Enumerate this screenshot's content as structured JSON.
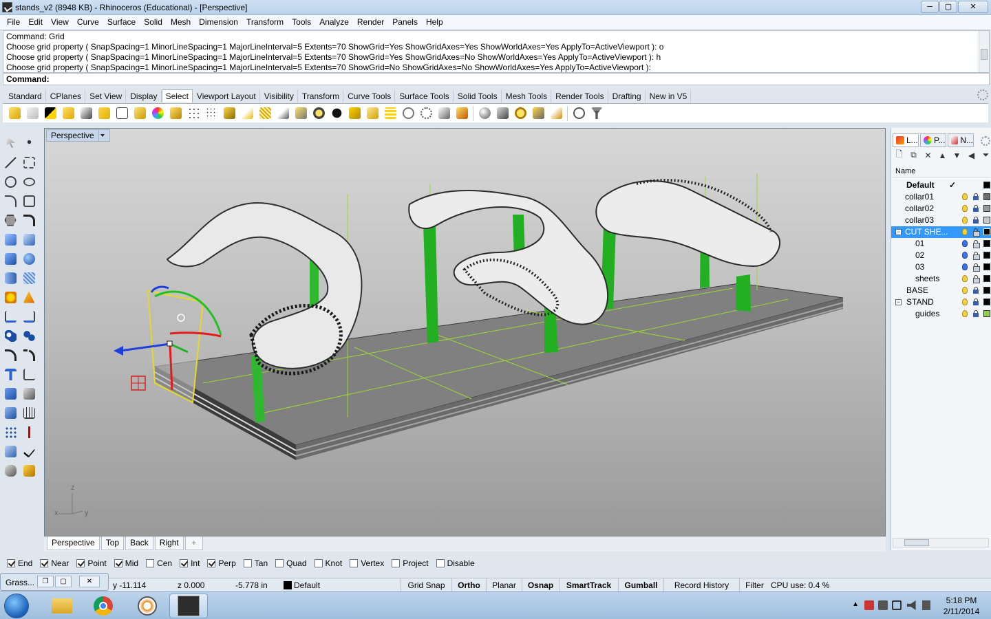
{
  "window": {
    "title": "stands_v2 (8948 KB) - Rhinoceros (Educational) - [Perspective]",
    "minimize": "─",
    "maximize": "▢",
    "close": "✕"
  },
  "menu": [
    "File",
    "Edit",
    "View",
    "Curve",
    "Surface",
    "Solid",
    "Mesh",
    "Dimension",
    "Transform",
    "Tools",
    "Analyze",
    "Render",
    "Panels",
    "Help"
  ],
  "command_history": [
    "Command: Grid",
    "Choose grid property ( SnapSpacing=1  MinorLineSpacing=1  MajorLineInterval=5  Extents=70  ShowGrid=Yes  ShowGridAxes=Yes  ShowWorldAxes=Yes  ApplyTo=ActiveViewport ): o",
    "Choose grid property ( SnapSpacing=1  MinorLineSpacing=1  MajorLineInterval=5  Extents=70  ShowGrid=Yes  ShowGridAxes=No  ShowWorldAxes=Yes  ApplyTo=ActiveViewport ): h",
    "Choose grid property ( SnapSpacing=1  MinorLineSpacing=1  MajorLineInterval=5  Extents=70  ShowGrid=No  ShowGridAxes=No  ShowWorldAxes=Yes  ApplyTo=ActiveViewport ):"
  ],
  "command_prompt": "Command:",
  "toolbar_tabs": [
    "Standard",
    "CPlanes",
    "Set View",
    "Display",
    "Select",
    "Viewport Layout",
    "Visibility",
    "Transform",
    "Curve Tools",
    "Surface Tools",
    "Solid Tools",
    "Mesh Tools",
    "Render Tools",
    "Drafting",
    "New in V5"
  ],
  "active_toolbar_tab": "Select",
  "viewport": {
    "name": "Perspective",
    "axis_x": "x",
    "axis_y": "y",
    "axis_z": "z"
  },
  "viewport_tabs": [
    "Perspective",
    "Top",
    "Back",
    "Right"
  ],
  "viewport_tab_add": "+",
  "osnaps": [
    {
      "label": "End",
      "checked": true
    },
    {
      "label": "Near",
      "checked": true
    },
    {
      "label": "Point",
      "checked": true
    },
    {
      "label": "Mid",
      "checked": true
    },
    {
      "label": "Cen",
      "checked": false
    },
    {
      "label": "Int",
      "checked": true
    },
    {
      "label": "Perp",
      "checked": true
    },
    {
      "label": "Tan",
      "checked": false
    },
    {
      "label": "Quad",
      "checked": false
    },
    {
      "label": "Knot",
      "checked": false
    },
    {
      "label": "Vertex",
      "checked": false
    },
    {
      "label": "Project",
      "checked": false
    },
    {
      "label": "Disable",
      "checked": false
    }
  ],
  "status": {
    "y": "y -11.114",
    "z": "z 0.000",
    "dist": "-5.778 in",
    "layer": "Default",
    "grid_snap": "Grid Snap",
    "ortho": "Ortho",
    "planar": "Planar",
    "osnap": "Osnap",
    "smarttrack": "SmartTrack",
    "gumball": "Gumball",
    "record_history": "Record History",
    "filter": "Filter",
    "cpu": "CPU use: 0.4 %"
  },
  "grasshopper": {
    "label": "Grass..."
  },
  "panel_tabs": [
    "L...",
    "P...",
    "N..."
  ],
  "layers": {
    "header": "Name",
    "rows": [
      {
        "name": "Default",
        "indent": 0,
        "current": true,
        "bulb": "yellow",
        "lock": "none",
        "color": "#000000"
      },
      {
        "name": "collar01",
        "indent": 1,
        "bulb": "yellow",
        "lock": "closed",
        "color": "#6e6e6e"
      },
      {
        "name": "collar02",
        "indent": 1,
        "bulb": "yellow",
        "lock": "closed",
        "color": "#9a9a9a"
      },
      {
        "name": "collar03",
        "indent": 1,
        "bulb": "yellow",
        "lock": "closed",
        "color": "#c8c8c8"
      },
      {
        "name": "CUT SHE...",
        "indent": 1,
        "selected": true,
        "expand": "−",
        "bulb": "yellow",
        "lock": "open",
        "color": "#000000"
      },
      {
        "name": "01",
        "indent": 2,
        "bulb": "blue",
        "lock": "open",
        "color": "#000000"
      },
      {
        "name": "02",
        "indent": 2,
        "bulb": "blue",
        "lock": "open",
        "color": "#000000"
      },
      {
        "name": "03",
        "indent": 2,
        "bulb": "blue",
        "lock": "open",
        "color": "#000000"
      },
      {
        "name": "sheets",
        "indent": 2,
        "bulb": "yellow",
        "lock": "open",
        "color": "#000000"
      },
      {
        "name": "BASE",
        "indent": 1,
        "bulb": "yellow",
        "lock": "closed",
        "color": "#000000"
      },
      {
        "name": "STAND",
        "indent": 1,
        "expand": "−",
        "bulb": "yellow",
        "lock": "closed",
        "color": "#000000"
      },
      {
        "name": "guides",
        "indent": 2,
        "bulb": "yellow",
        "lock": "closed",
        "color": "#8fd14f"
      }
    ]
  },
  "taskbar": {
    "time": "5:18 PM",
    "date": "2/11/2014"
  }
}
